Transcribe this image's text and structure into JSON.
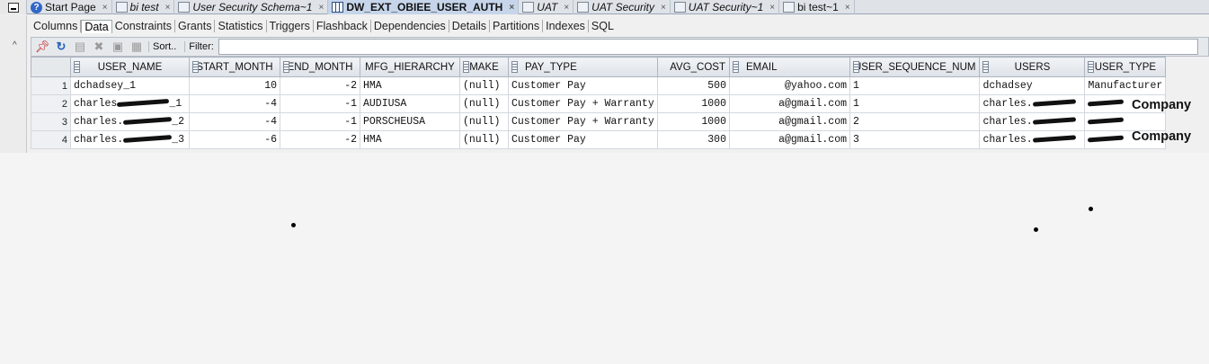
{
  "doc_tabs": [
    {
      "label": "Start Page",
      "icon": "help-icon",
      "italic": false,
      "active": false
    },
    {
      "label": "bi test",
      "icon": "sql-icon",
      "italic": true,
      "active": false
    },
    {
      "label": "User Security Schema~1",
      "icon": "sql-icon",
      "italic": true,
      "active": false
    },
    {
      "label": "DW_EXT_OBIEE_USER_AUTH",
      "icon": "table-grid-icon",
      "italic": false,
      "active": true
    },
    {
      "label": "UAT",
      "icon": "sql-icon",
      "italic": true,
      "active": false
    },
    {
      "label": "UAT Security",
      "icon": "sql-icon",
      "italic": true,
      "active": false
    },
    {
      "label": "UAT Security~1",
      "icon": "sql-icon",
      "italic": true,
      "active": false
    },
    {
      "label": "bi test~1",
      "icon": "sql-icon",
      "italic": false,
      "active": false
    }
  ],
  "close_glyph": "×",
  "sub_tabs": [
    "Columns",
    "Data",
    "Constraints",
    "Grants",
    "Statistics",
    "Triggers",
    "Flashback",
    "Dependencies",
    "Details",
    "Partitions",
    "Indexes",
    "SQL"
  ],
  "active_sub_tab": "Data",
  "toolbar": {
    "sort_label": "Sort..",
    "filter_label": "Filter:",
    "filter_value": ""
  },
  "columns": [
    "USER_NAME",
    "START_MONTH",
    "END_MONTH",
    "MFG_HIERARCHY",
    "MAKE",
    "PAY_TYPE",
    "AVG_COST",
    "EMAIL",
    "USER_SEQUENCE_NUM",
    "USERS",
    "USER_TYPE"
  ],
  "rows": [
    {
      "n": "1",
      "user_name_a": "dchadsey_1",
      "user_name_b": "",
      "start": "10",
      "end": "-2",
      "mfg": "HMA",
      "make": "(null)",
      "pay": "Customer Pay",
      "cost": "500",
      "email": "@yahoo.com",
      "seq": "1",
      "users": "dchadsey",
      "type": "Manufacturer"
    },
    {
      "n": "2",
      "user_name_a": "charles",
      "user_name_b": "_1",
      "start": "-4",
      "end": "-1",
      "mfg": "AUDIUSA",
      "make": "(null)",
      "pay": "Customer Pay + Warranty",
      "cost": "1000",
      "email": "a@gmail.com",
      "seq": "1",
      "users": "charles.",
      "type": ""
    },
    {
      "n": "3",
      "user_name_a": "charles.",
      "user_name_b": "_2",
      "start": "-4",
      "end": "-1",
      "mfg": "PORSCHEUSA",
      "make": "(null)",
      "pay": "Customer Pay + Warranty",
      "cost": "1000",
      "email": "a@gmail.com",
      "seq": "2",
      "users": "charles.",
      "type": ""
    },
    {
      "n": "4",
      "user_name_a": "charles.",
      "user_name_b": "_3",
      "start": "-6",
      "end": "-2",
      "mfg": "HMA",
      "make": "(null)",
      "pay": "Customer Pay",
      "cost": "300",
      "email": "a@gmail.com",
      "seq": "3",
      "users": "charles.",
      "type": ""
    }
  ],
  "annotations": {
    "company_1": "Company",
    "company_2": "Company"
  }
}
